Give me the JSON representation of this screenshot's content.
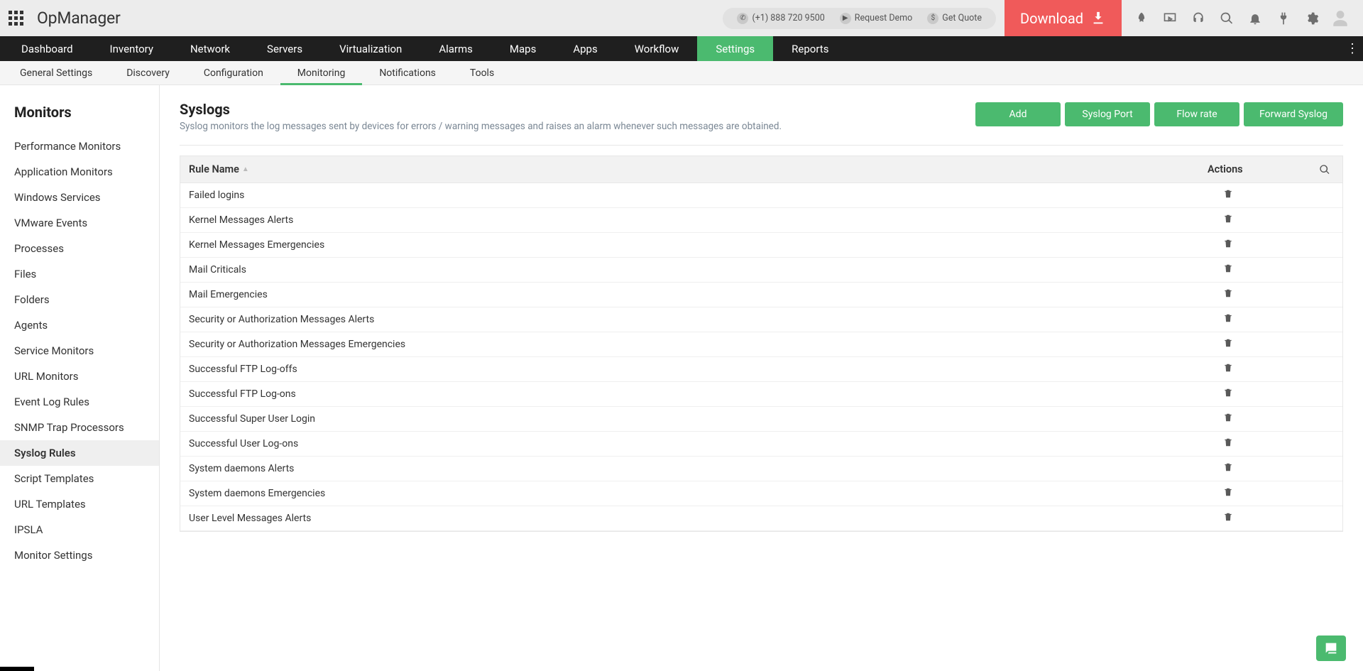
{
  "brand": "OpManager",
  "top": {
    "phone": "(+1) 888 720 9500",
    "request_demo": "Request Demo",
    "get_quote": "Get Quote",
    "download": "Download"
  },
  "mainnav": [
    "Dashboard",
    "Inventory",
    "Network",
    "Servers",
    "Virtualization",
    "Alarms",
    "Maps",
    "Apps",
    "Workflow",
    "Settings",
    "Reports"
  ],
  "mainnav_active": "Settings",
  "subnav": [
    "General Settings",
    "Discovery",
    "Configuration",
    "Monitoring",
    "Notifications",
    "Tools"
  ],
  "subnav_active": "Monitoring",
  "sidebar": {
    "title": "Monitors",
    "items": [
      "Performance Monitors",
      "Application Monitors",
      "Windows Services",
      "VMware Events",
      "Processes",
      "Files",
      "Folders",
      "Agents",
      "Service Monitors",
      "URL Monitors",
      "Event Log Rules",
      "SNMP Trap Processors",
      "Syslog Rules",
      "Script Templates",
      "URL Templates",
      "IPSLA",
      "Monitor Settings"
    ],
    "active": "Syslog Rules"
  },
  "page": {
    "title": "Syslogs",
    "description": "Syslog monitors the log messages sent by devices for errors / warning messages and raises an alarm whenever such messages are obtained.",
    "buttons": [
      "Add",
      "Syslog Port",
      "Flow rate",
      "Forward Syslog"
    ]
  },
  "table": {
    "col_rule": "Rule Name",
    "col_actions": "Actions",
    "rows": [
      "Failed logins",
      "Kernel Messages Alerts",
      "Kernel Messages Emergencies",
      "Mail Criticals",
      "Mail Emergencies",
      "Security or Authorization Messages Alerts",
      "Security or Authorization Messages Emergencies",
      "Successful FTP Log-offs",
      "Successful FTP Log-ons",
      "Successful Super User Login",
      "Successful User Log-ons",
      "System daemons Alerts",
      "System daemons Emergencies",
      "User Level Messages Alerts"
    ]
  }
}
